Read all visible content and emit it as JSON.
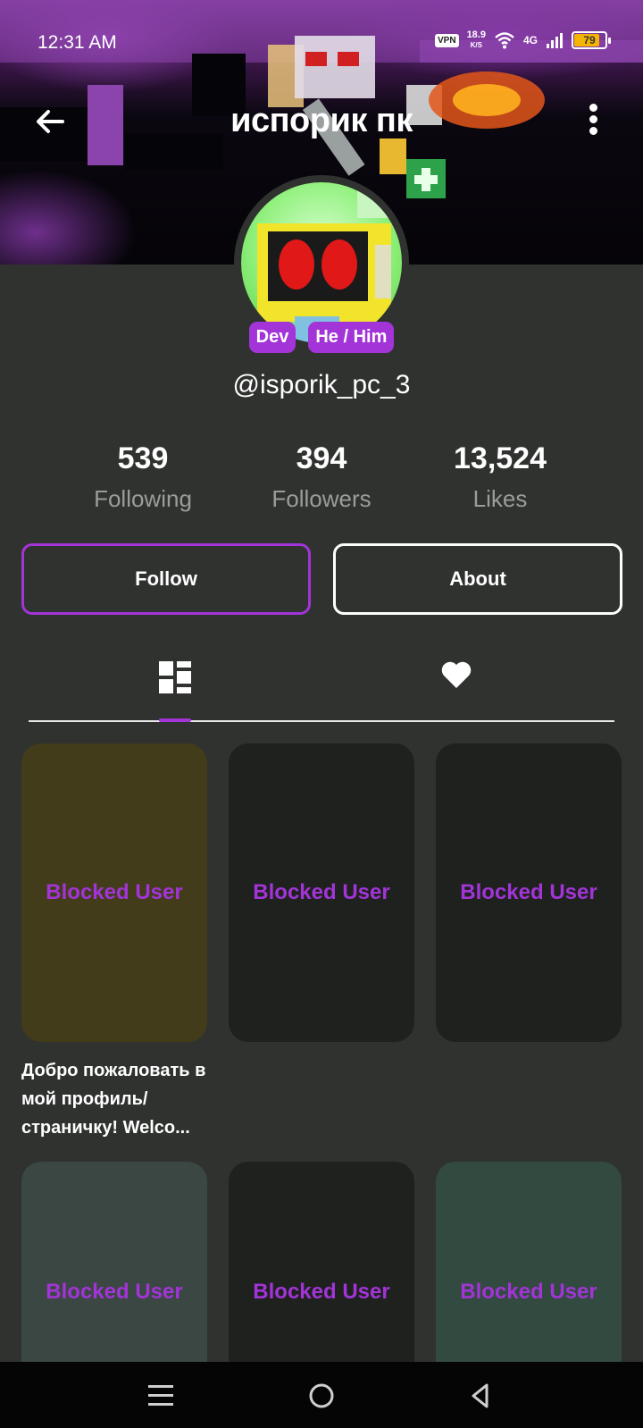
{
  "status_bar": {
    "time": "12:31 AM",
    "vpn": "VPN",
    "speed_value": "18.9",
    "speed_unit": "K/S",
    "network": "4G",
    "battery": "79"
  },
  "header": {
    "title": "испорик пк",
    "back_icon": "arrow-left-icon",
    "more_icon": "more-vertical-icon"
  },
  "profile": {
    "badges": [
      "Dev",
      "He / Him"
    ],
    "handle": "@isporik_pc_3"
  },
  "stats": [
    {
      "value": "539",
      "label": "Following"
    },
    {
      "value": "394",
      "label": "Followers"
    },
    {
      "value": "13,524",
      "label": "Likes"
    }
  ],
  "actions": {
    "follow_label": "Follow",
    "about_label": "About"
  },
  "tabs": {
    "posts_icon": "grid-layout-icon",
    "likes_icon": "heart-icon"
  },
  "posts": [
    {
      "label": "Blocked User",
      "color": "#433c1a"
    },
    {
      "label": "Blocked User",
      "color": "#1f211f"
    },
    {
      "label": "Blocked User",
      "color": "#1f211f"
    },
    {
      "label": "Blocked User",
      "color": "#3a4742"
    },
    {
      "label": "Blocked User",
      "color": "#1f211f"
    },
    {
      "label": "Blocked User",
      "color": "#334a40"
    }
  ],
  "post_caption": "Добро пожаловать в мой профиль/страничку! Welco...",
  "colors": {
    "accent": "#a234d8",
    "background": "#2f322f"
  },
  "navigation": [
    "menu-icon",
    "home-circle-icon",
    "back-triangle-icon"
  ]
}
